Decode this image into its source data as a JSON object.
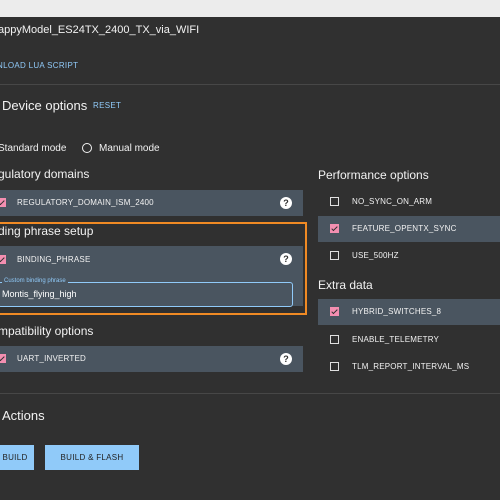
{
  "target": {
    "title": "appyModel_ES24TX_2400_TX_via_WIFI",
    "download_link": "NLOAD LUA SCRIPT"
  },
  "device_options": {
    "heading": "Device options",
    "reset_label": "RESET",
    "modes": [
      {
        "label": "Standard mode",
        "selected": true
      },
      {
        "label": "Manual mode",
        "selected": false
      }
    ]
  },
  "regulatory": {
    "heading": "gulatory domains",
    "item": {
      "label": "REGULATORY_DOMAIN_ISM_2400",
      "checked": true
    }
  },
  "binding": {
    "heading": "ding phrase setup",
    "item": {
      "label": "BINDING_PHRASE",
      "checked": true
    },
    "field_label": "Custom binding phrase",
    "field_value": "Montis_flying_high"
  },
  "compatibility": {
    "heading": "mpatibility options",
    "item": {
      "label": "UART_INVERTED",
      "checked": true
    }
  },
  "performance": {
    "heading": "Performance options",
    "items": [
      {
        "label": "NO_SYNC_ON_ARM",
        "checked": false
      },
      {
        "label": "FEATURE_OPENTX_SYNC",
        "checked": true
      },
      {
        "label": "USE_500HZ",
        "checked": false
      }
    ]
  },
  "extra": {
    "heading": "Extra data",
    "items": [
      {
        "label": "HYBRID_SWITCHES_8",
        "checked": true
      },
      {
        "label": "ENABLE_TELEMETRY",
        "checked": false
      },
      {
        "label": "TLM_REPORT_INTERVAL_MS",
        "checked": false
      }
    ]
  },
  "actions": {
    "heading": "Actions",
    "build_label": "BUILD",
    "build_flash_label": "BUILD & FLASH"
  },
  "colors": {
    "background": "#303030",
    "accent": "#90caf9",
    "checkbox_checked": "#f48fb1",
    "option_bar": "#4a5560",
    "highlight_frame": "#f08a24"
  }
}
